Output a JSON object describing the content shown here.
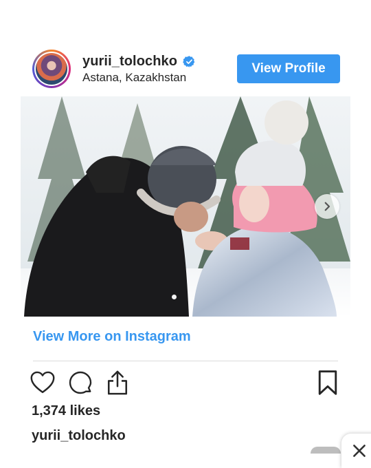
{
  "header": {
    "username": "yurii_tolochko",
    "location": "Astana, Kazakhstan",
    "view_profile_label": "View Profile",
    "verified_icon": "verified-badge-icon"
  },
  "post": {
    "image_description_icon": "post-photo",
    "carousel": {
      "current_index": 1,
      "total_visible_dots": 1
    },
    "view_more_label": "View More on Instagram",
    "likes_text": "1,374 likes",
    "caption_username": "yurii_tolochko"
  },
  "actions": {
    "like_icon": "heart-icon",
    "comment_icon": "comment-icon",
    "share_icon": "share-icon",
    "save_icon": "bookmark-icon"
  },
  "colors": {
    "accent": "#3897f0",
    "text": "#262626",
    "divider": "#dbdbdb",
    "verified": "#3897f0"
  }
}
